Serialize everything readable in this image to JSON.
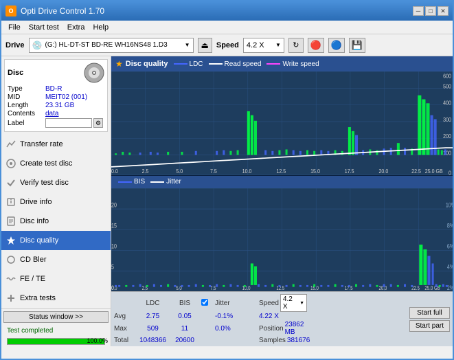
{
  "titleBar": {
    "title": "Opti Drive Control 1.70",
    "icon": "O"
  },
  "menuBar": {
    "items": [
      "File",
      "Start test",
      "Extra",
      "Help"
    ]
  },
  "driveBar": {
    "label": "Drive",
    "driveText": "(G:)  HL-DT-ST BD-RE  WH16NS48 1.D3",
    "speedLabel": "Speed",
    "speedValue": "4.2 X"
  },
  "disc": {
    "title": "Disc",
    "typeLabel": "Type",
    "typeValue": "BD-R",
    "midLabel": "MID",
    "midValue": "MEIT02 (001)",
    "lengthLabel": "Length",
    "lengthValue": "23.31 GB",
    "contentsLabel": "Contents",
    "contentsValue": "data",
    "labelLabel": "Label",
    "labelValue": ""
  },
  "navItems": [
    {
      "id": "transfer-rate",
      "label": "Transfer rate",
      "icon": "📈"
    },
    {
      "id": "create-test-disc",
      "label": "Create test disc",
      "icon": "💿"
    },
    {
      "id": "verify-test-disc",
      "label": "Verify test disc",
      "icon": "✓"
    },
    {
      "id": "drive-info",
      "label": "Drive info",
      "icon": "ℹ"
    },
    {
      "id": "disc-info",
      "label": "Disc info",
      "icon": "📄"
    },
    {
      "id": "disc-quality",
      "label": "Disc quality",
      "icon": "★",
      "active": true
    },
    {
      "id": "cd-bler",
      "label": "CD Bler",
      "icon": "🔵"
    },
    {
      "id": "fe-te",
      "label": "FE / TE",
      "icon": "〰"
    },
    {
      "id": "extra-tests",
      "label": "Extra tests",
      "icon": "+"
    }
  ],
  "statusWindow": {
    "buttonLabel": "Status window >>",
    "statusText": "Test completed",
    "progressPercent": 100,
    "progressLabel": "100.0%"
  },
  "discQuality": {
    "title": "Disc quality",
    "legend": [
      {
        "label": "LDC",
        "color": "#4444ff"
      },
      {
        "label": "Read speed",
        "color": "#ffffff"
      },
      {
        "label": "Write speed",
        "color": "#ff44ff"
      }
    ],
    "legend2": [
      {
        "label": "BIS",
        "color": "#4444ff"
      },
      {
        "label": "Jitter",
        "color": "#ffffff"
      }
    ]
  },
  "statsBottom": {
    "headers": [
      "LDC",
      "BIS",
      "",
      "Jitter",
      "Speed",
      ""
    ],
    "avgLabel": "Avg",
    "avgLDC": "2.75",
    "avgBIS": "0.05",
    "avgJitter": "-0.1%",
    "avgSpeed": "4.22 X",
    "maxLabel": "Max",
    "maxLDC": "509",
    "maxBIS": "11",
    "maxJitter": "0.0%",
    "maxSpeedLabel": "Position",
    "maxPosition": "23862 MB",
    "totalLabel": "Total",
    "totalLDC": "1048366",
    "totalBIS": "20600",
    "totalSamplesLabel": "Samples",
    "totalSamples": "381676",
    "speedDropdown": "4.2 X",
    "jitterChecked": true,
    "jitterLabel": "Jitter",
    "startFullLabel": "Start full",
    "startPartLabel": "Start part"
  }
}
